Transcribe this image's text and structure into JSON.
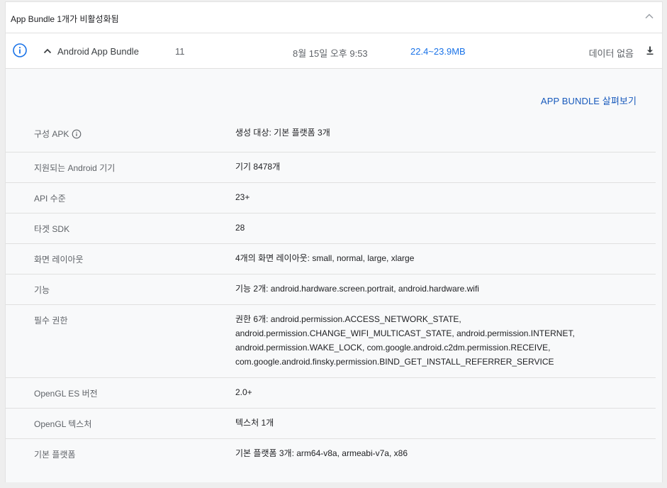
{
  "section": {
    "title": "App Bundle 1개가 비활성화됨"
  },
  "bundle": {
    "name": "Android App Bundle",
    "version": "11",
    "date": "8월 15일 오후 9:53",
    "size": "22.4~23.9MB",
    "data_status": "데이터 없음"
  },
  "details": {
    "explore_label": "APP BUNDLE 살펴보기",
    "rows": [
      {
        "label": "구성 APK",
        "value": "생성 대상: 기본 플랫폼 3개"
      },
      {
        "label": "지원되는 Android 기기",
        "value": "기기 8478개"
      },
      {
        "label": "API 수준",
        "value": "23+"
      },
      {
        "label": "타겟 SDK",
        "value": "28"
      },
      {
        "label": "화면 레이아웃",
        "value": "4개의 화면 레이아웃: small, normal, large, xlarge"
      },
      {
        "label": "기능",
        "value": "기능 2개: android.hardware.screen.portrait, android.hardware.wifi"
      },
      {
        "label": "필수 권한",
        "value": [
          "권한 6개: android.permission.ACCESS_NETWORK_STATE,",
          "android.permission.CHANGE_WIFI_MULTICAST_STATE, android.permission.INTERNET,",
          "android.permission.WAKE_LOCK, com.google.android.c2dm.permission.RECEIVE,",
          "com.google.android.finsky.permission.BIND_GET_INSTALL_REFERRER_SERVICE"
        ]
      },
      {
        "label": "OpenGL ES 버전",
        "value": "2.0+"
      },
      {
        "label": "OpenGL 텍스처",
        "value": "텍스처 1개"
      },
      {
        "label": "기본 플랫폼",
        "value": "기본 플랫폼 3개: arm64-v8a, armeabi-v7a, x86"
      }
    ]
  },
  "colors": {
    "accent_link": "#185abc",
    "size_link": "#1a73e8",
    "info_icon": "#1a73e8"
  },
  "icons": {
    "collapse": "chevron-up-icon",
    "info": "info-icon",
    "expand": "chevron-up-icon",
    "download": "download-icon"
  }
}
